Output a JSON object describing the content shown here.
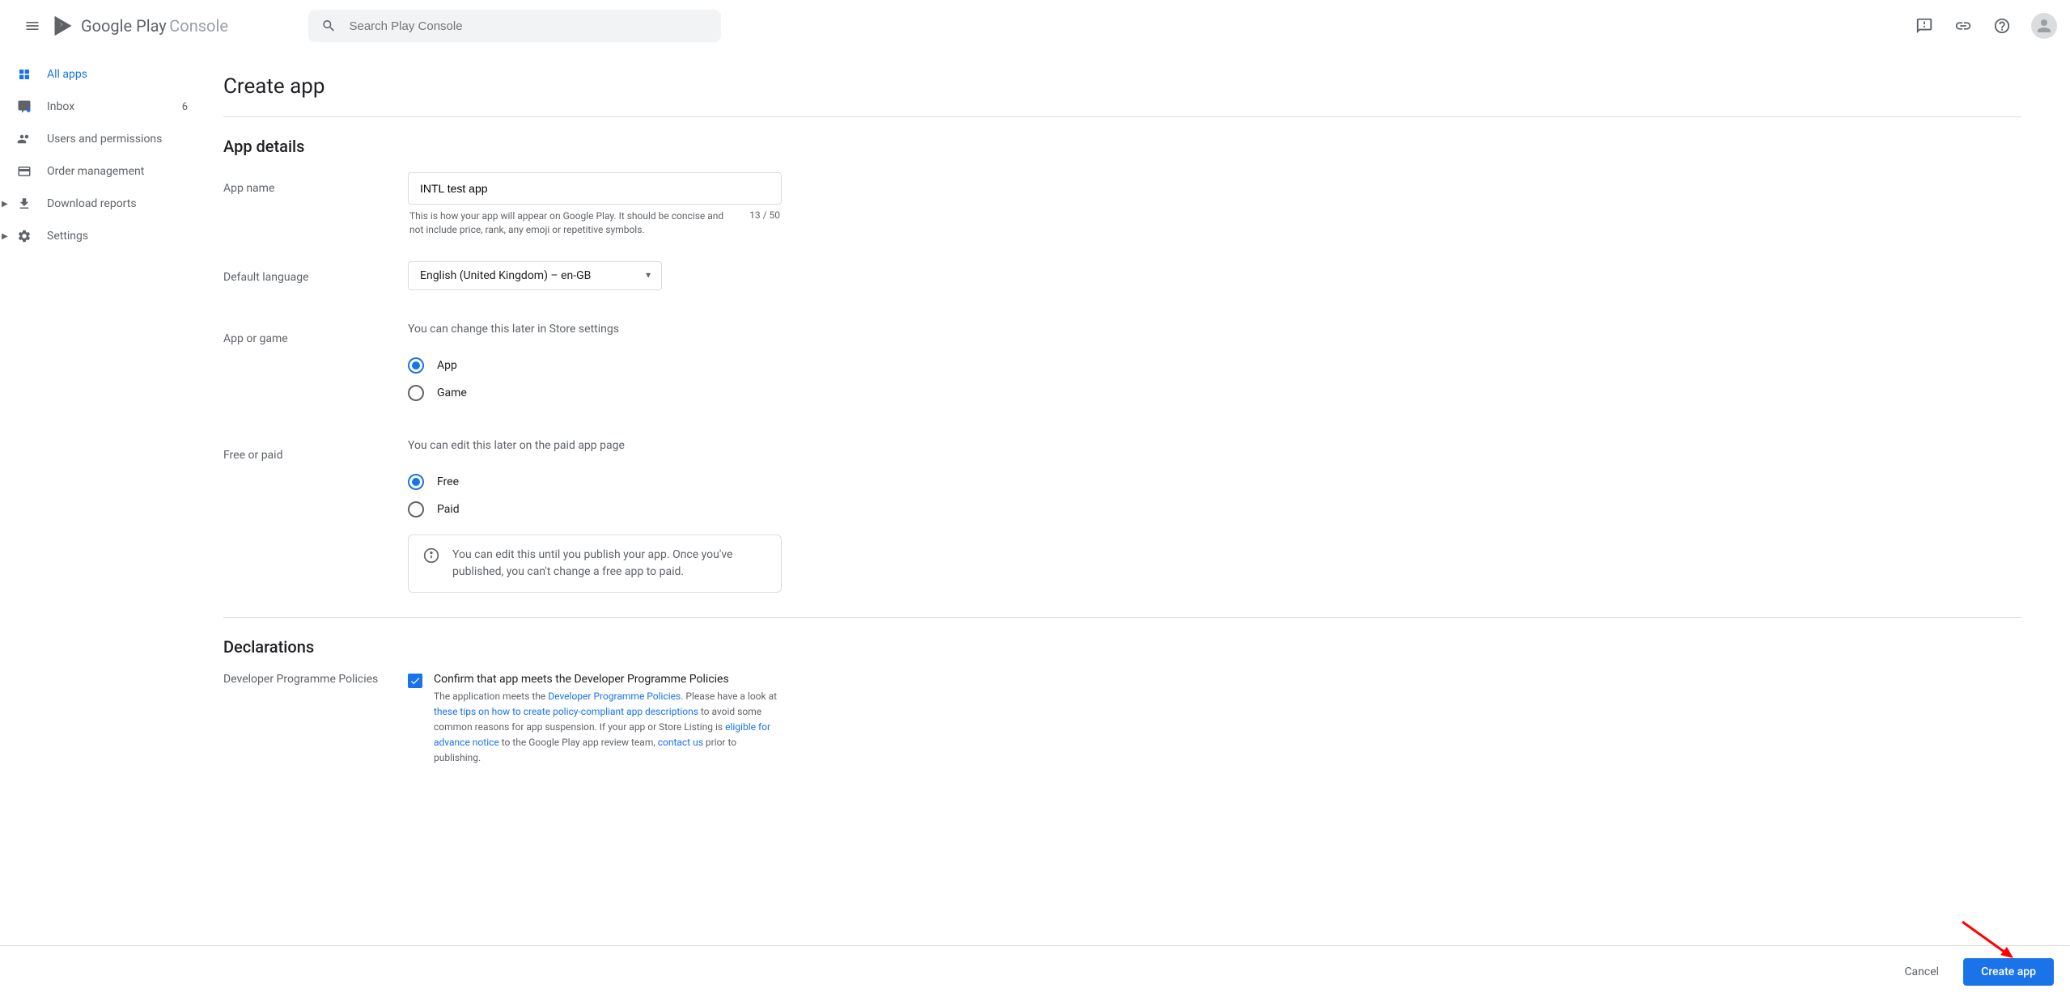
{
  "header": {
    "logo_text1": "Google Play",
    "logo_text2": "Console",
    "search_placeholder": "Search Play Console"
  },
  "sidebar": {
    "items": [
      {
        "label": "All apps",
        "badge": ""
      },
      {
        "label": "Inbox",
        "badge": "6"
      },
      {
        "label": "Users and permissions",
        "badge": ""
      },
      {
        "label": "Order management",
        "badge": ""
      },
      {
        "label": "Download reports",
        "badge": ""
      },
      {
        "label": "Settings",
        "badge": ""
      }
    ]
  },
  "page": {
    "title": "Create app",
    "sections": {
      "app_details": "App details",
      "declarations": "Declarations"
    },
    "app_name": {
      "label": "App name",
      "value": "INTL test app",
      "help": "This is how your app will appear on Google Play. It should be concise and not include price, rank, any emoji or repetitive symbols.",
      "counter": "13 / 50"
    },
    "default_language": {
      "label": "Default language",
      "value": "English (United Kingdom) – en-GB"
    },
    "app_or_game": {
      "label": "App or game",
      "hint": "You can change this later in Store settings",
      "option1": "App",
      "option2": "Game"
    },
    "free_or_paid": {
      "label": "Free or paid",
      "hint": "You can edit this later on the paid app page",
      "option1": "Free",
      "option2": "Paid",
      "info": "You can edit this until you publish your app. Once you've published, you can't change a free app to paid."
    },
    "declarations": {
      "label": "Developer Programme Policies",
      "checkbox_label": "Confirm that app meets the Developer Programme Policies",
      "text1": "The application meets the ",
      "link1": "Developer Programme Policies",
      "text2": ". Please have a look at ",
      "link2": "these tips on how to create policy-compliant app descriptions",
      "text3": " to avoid some common reasons for app suspension. If your app or Store Listing is ",
      "link3": "eligible for advance notice",
      "text4": " to the Google Play app review team, ",
      "link4": "contact us",
      "text5": " prior to publishing."
    }
  },
  "footer": {
    "cancel": "Cancel",
    "create": "Create app"
  }
}
